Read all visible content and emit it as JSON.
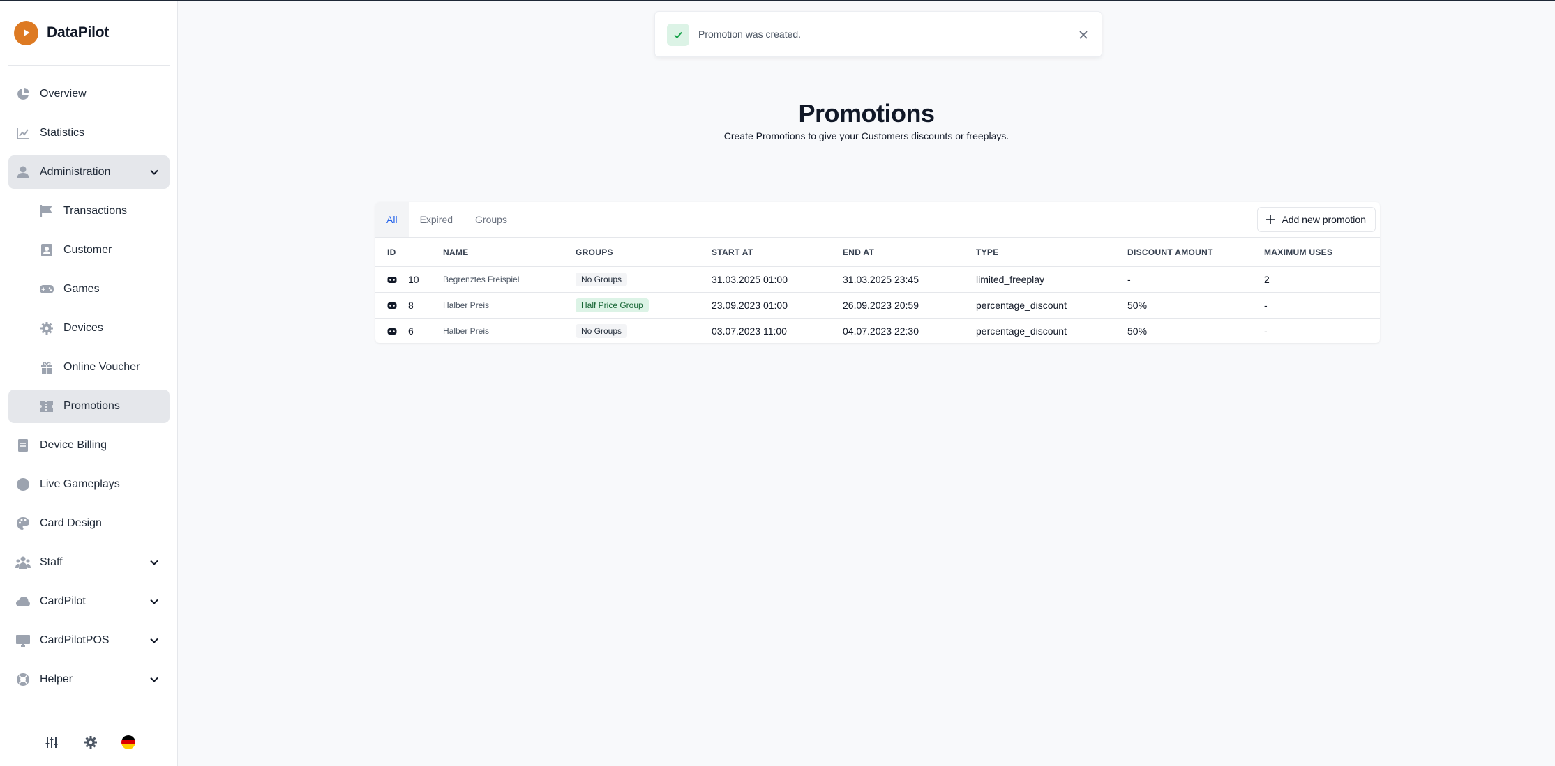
{
  "app": {
    "name": "DataPilot"
  },
  "sidebar": {
    "items": [
      {
        "label": "Overview",
        "icon": "pie-chart-icon"
      },
      {
        "label": "Statistics",
        "icon": "line-chart-icon"
      },
      {
        "label": "Administration",
        "icon": "user-icon",
        "expanded": true
      },
      {
        "label": "Transactions",
        "icon": "flag-icon"
      },
      {
        "label": "Customer",
        "icon": "contact-card-icon"
      },
      {
        "label": "Games",
        "icon": "gamepad-icon"
      },
      {
        "label": "Devices",
        "icon": "cog-icon"
      },
      {
        "label": "Online Voucher",
        "icon": "gift-icon"
      },
      {
        "label": "Promotions",
        "icon": "ticket-icon",
        "active": true
      },
      {
        "label": "Device Billing",
        "icon": "document-icon"
      },
      {
        "label": "Live Gameplays",
        "icon": "circle-icon"
      },
      {
        "label": "Card Design",
        "icon": "palette-icon"
      },
      {
        "label": "Staff",
        "icon": "users-icon"
      },
      {
        "label": "CardPilot",
        "icon": "cloud-icon"
      },
      {
        "label": "CardPilotPOS",
        "icon": "monitor-icon"
      },
      {
        "label": "Helper",
        "icon": "lifebuoy-icon"
      }
    ],
    "footer": [
      "sliders-icon",
      "settings-icon",
      "german-flag-icon"
    ]
  },
  "toast": {
    "message": "Promotion was created."
  },
  "page": {
    "title": "Promotions",
    "subtitle": "Create Promotions to give your Customers discounts or freeplays."
  },
  "tabs": [
    "All",
    "Expired",
    "Groups"
  ],
  "add_button": "Add new promotion",
  "table": {
    "columns": [
      "ID",
      "NAME",
      "GROUPS",
      "START AT",
      "END AT",
      "TYPE",
      "DISCOUNT AMOUNT",
      "MAXIMUM USES"
    ],
    "rows": [
      {
        "id": "10",
        "name": "Begrenztes Freispiel",
        "groups": "No Groups",
        "start": "31.03.2025 01:00",
        "end": "31.03.2025 23:45",
        "type": "limited_freeplay",
        "discount": "-",
        "max_uses": "2"
      },
      {
        "id": "8",
        "name": "Halber Preis",
        "groups": "Half Price Group",
        "start": "23.09.2023 01:00",
        "end": "26.09.2023 20:59",
        "type": "percentage_discount",
        "discount": "50%",
        "max_uses": "-"
      },
      {
        "id": "6",
        "name": "Halber Preis",
        "groups": "No Groups",
        "start": "03.07.2023 11:00",
        "end": "04.07.2023 22:30",
        "type": "percentage_discount",
        "discount": "50%",
        "max_uses": "-"
      }
    ]
  },
  "colors": {
    "brand": "#dd7a23",
    "accent": "#2563eb",
    "success_bg": "#dcf3e6",
    "success": "#16a34a"
  }
}
